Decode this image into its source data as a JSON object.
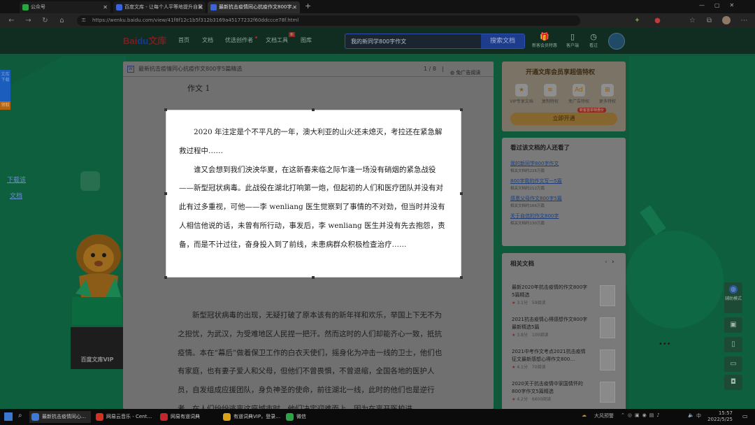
{
  "browser": {
    "tabs": [
      {
        "label": "公众号",
        "active": false
      },
      {
        "label": "百度文库 - 让每个人平等地提升自我",
        "active": false
      },
      {
        "label": "最新抗击疫情同心抗疫作文800字…",
        "active": true
      }
    ],
    "new_tab_symbol": "+",
    "url": "https://wenku.baidu.com/view/41f8f12c1b5f312b3169a4517723​2f60ddccce78f.html"
  },
  "site": {
    "logo_bai": "Bai",
    "logo_du": "du",
    "logo_wenku": "文库",
    "nav": [
      "首页",
      "文档",
      "优选创作者",
      "文档工具",
      "图库"
    ],
    "tools_badge": "新",
    "search_value": "我的新同学800字作文",
    "search_button": "搜索文档",
    "right_nav": [
      {
        "icon": "gift-icon",
        "label": "新客会员特惠"
      },
      {
        "icon": "device-icon",
        "label": "客户端"
      },
      {
        "icon": "clock-icon",
        "label": "看过"
      }
    ]
  },
  "left": {
    "strip_text": "文库下载",
    "strip_badge": "领取",
    "links": [
      "下载该",
      "文档"
    ],
    "vip_label": "百度文库VIP"
  },
  "document": {
    "title": "最新抗击疫情同心抗疫作文800字5篇精选",
    "page_indicator": "1 / 8",
    "ad_free": "免广告阅读",
    "heading": "作文 1",
    "paragraphs_selected": [
      "2020 年注定是个不平凡的一年，澳大利亚的山火还未熄灭，考拉还在紧急解救过程中……",
      "谁又会想到我们泱泱华夏，在这新春来临之际乍逢一场没有硝烟的紧急战役——新型冠状病毒。此战役在湖北打响第一炮，但起初的人们和医疗团队并没有对此有过多重视，可他——李 wenliang 医生觉察到了事情的不对劲，但当时并没有人相信他说的话，未曾有所行动，事发后，李 wenliang 医生并没有先去抱怨，责备，而是不计过往，奋身投入到了前线，未患病群众积极检查治疗……"
    ],
    "paragraph_after": "新型冠状病毒的出现，无疑打破了原本该有的新年祥和欢乐，举国上下无不为之担忧，为武汉，为受难地区人民捏一把汗。然而这时的人们却能齐心一致，抵抗疫情。本在“幕后”做着保卫工作的白衣天使们，摇身化为冲击一线的卫士，他们也有家庭，也有妻子爱人和父母，但他们不曾畏惧，不曾退缩，全国各地的医护人员，自发组成应援团队，身负神圣的使命，前往湖北一线，此时的他们也是逆行者，在人们纷纷逃离这座城市时，他们决定迎难而上，因为在离开医校进"
  },
  "vip_panel": {
    "title": "开通文库会员享超值特权",
    "features": [
      {
        "icon": "star-icon",
        "label": "VIP专享文档"
      },
      {
        "icon": "copy-icon",
        "label": "复制特权"
      },
      {
        "icon": "ad-icon",
        "label": "免广告特权"
      },
      {
        "icon": "more-icon",
        "label": "更多特权"
      }
    ],
    "badge": "新客首单特惠价",
    "button": "立即开通"
  },
  "also_viewed": {
    "title": "看过该文档的人还看了",
    "items": [
      {
        "title": "我的新同学800字作文",
        "meta": "相关文档约22​6万篇"
      },
      {
        "title": "800字我的作文写一5篇",
        "meta": "相关文档约212万篇"
      },
      {
        "title": "感恩父母作文800字5篇",
        "meta": "相关文档约166万篇"
      },
      {
        "title": "关于自信的作文800字",
        "meta": "相关文档约130万篇"
      }
    ]
  },
  "related": {
    "title": "相关文档",
    "items": [
      {
        "title": "最新2020年抗击疫情的作文800字5篇精选",
        "rating": "3.1分",
        "reads": "59阅读"
      },
      {
        "title": "2021抗击疫情心得感想作文800字最新精选5篇",
        "rating": "3.8分",
        "reads": "100阅读"
      },
      {
        "title": "2021中考作文考点2021抗击疫情征文最新感想心得作文800…",
        "rating": "4.1分",
        "reads": "70阅读"
      },
      {
        "title": "2020关于抗击疫情中家国情怀的800字作文5篇精选",
        "rating": "4.2分",
        "reads": "6600阅读"
      }
    ]
  },
  "side_tools": {
    "assist_label": "辅助模式",
    "icons": [
      "briefcase-icon",
      "phone-icon",
      "chat-icon",
      "bag-icon"
    ]
  },
  "taskbar": {
    "apps": [
      {
        "label": "最新抗击疫情同心…",
        "color": "#3b7ad8",
        "active": true
      },
      {
        "label": "网易云音乐 - Cent…",
        "color": "#d0331f",
        "active": false
      },
      {
        "label": "网易有道词典",
        "color": "#c0262c",
        "active": false
      },
      {
        "label": "有道词典VIP，登录…",
        "color": "#d8a21b",
        "active": false
      },
      {
        "label": "微信",
        "color": "#2aa445",
        "active": false
      }
    ],
    "weather": "大风预警",
    "ime": "中",
    "time": "15:57",
    "date": "2022/5/25"
  }
}
